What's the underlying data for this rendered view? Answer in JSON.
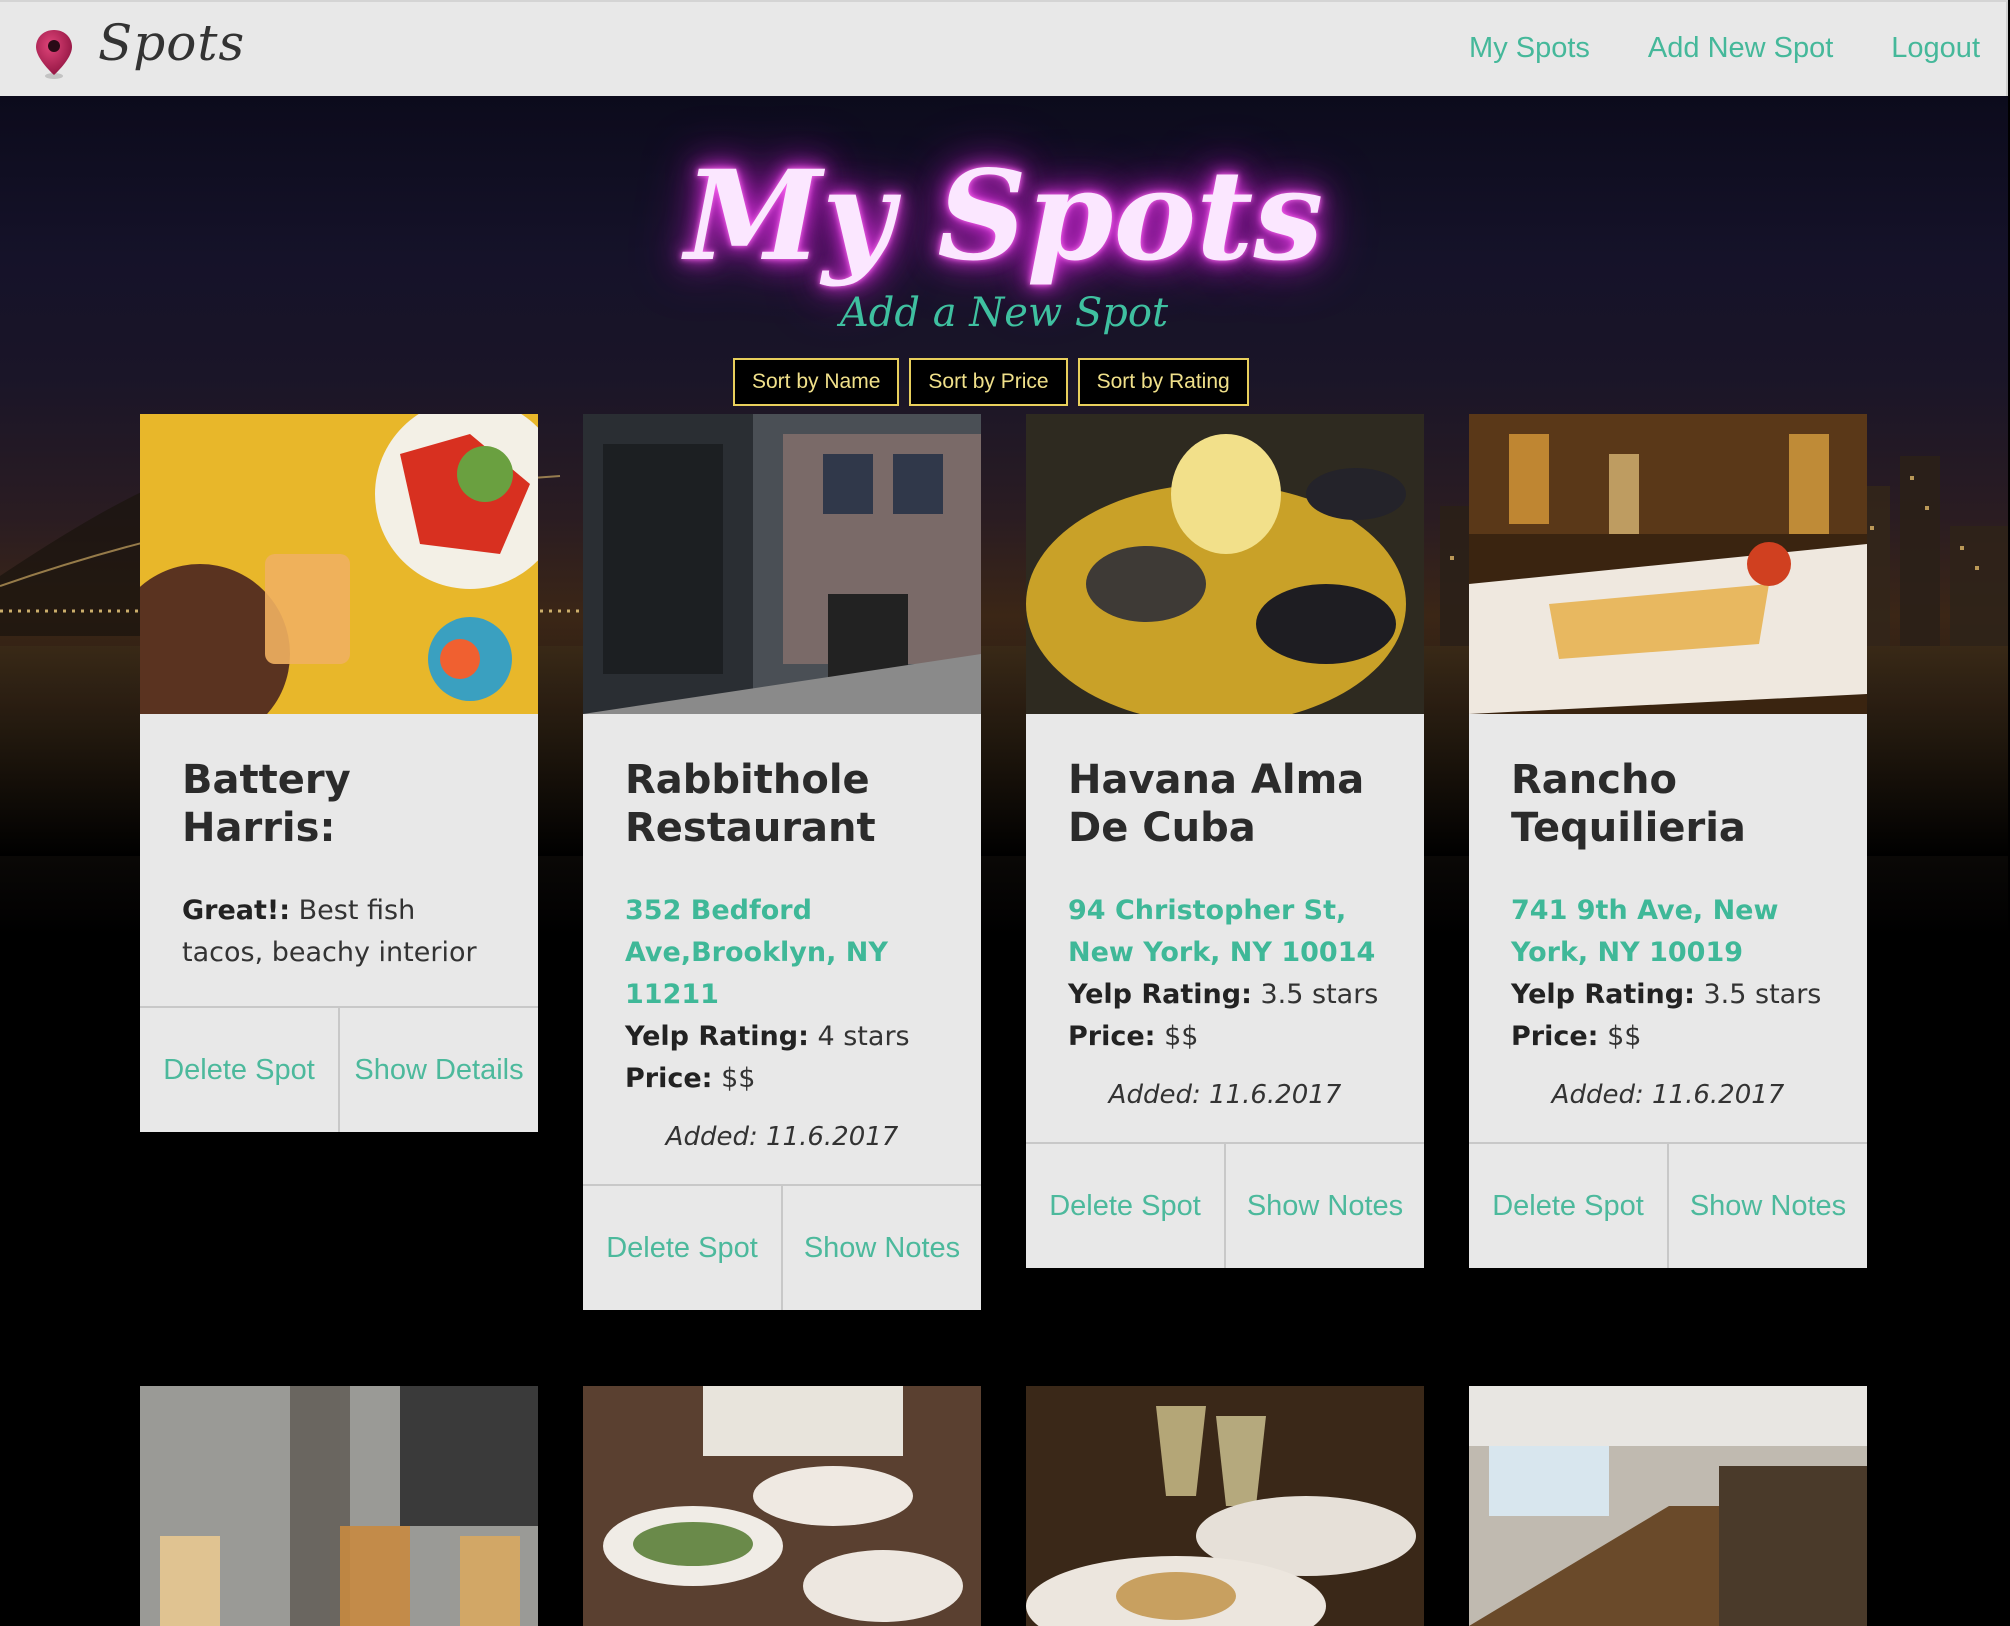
{
  "navbar": {
    "brand": "Spots",
    "links": [
      "My Spots",
      "Add New Spot",
      "Logout"
    ]
  },
  "hero": {
    "title": "My Spots",
    "subtitle": "Add a New Spot"
  },
  "sort_buttons": [
    "Sort by Name",
    "Sort by Price",
    "Sort by Rating"
  ],
  "cards": [
    {
      "name": "Battery Harris:",
      "note_label": "Great!:",
      "note_text": "Best fish tacos, beachy interior",
      "actions": [
        "Delete Spot",
        "Show Details"
      ]
    },
    {
      "name": "Rabbithole Restaurant",
      "address": "352 Bedford Ave,Brooklyn, NY 11211",
      "yelp_label": "Yelp Rating:",
      "yelp_value": "4 stars",
      "price_label": "Price:",
      "price_value": "$$",
      "added": "Added: 11.6.2017",
      "actions": [
        "Delete Spot",
        "Show Notes"
      ]
    },
    {
      "name": "Havana Alma De Cuba",
      "address": "94 Christopher St, New York, NY 10014",
      "yelp_label": "Yelp Rating:",
      "yelp_value": "3.5 stars",
      "price_label": "Price:",
      "price_value": "$$",
      "added": "Added: 11.6.2017",
      "actions": [
        "Delete Spot",
        "Show Notes"
      ]
    },
    {
      "name": "Rancho Tequilieria",
      "address": "741 9th Ave, New York, NY 10019",
      "yelp_label": "Yelp Rating:",
      "yelp_value": "3.5 stars",
      "price_label": "Price:",
      "price_value": "$$",
      "added": "Added: 11.6.2017",
      "actions": [
        "Delete Spot",
        "Show Notes"
      ]
    }
  ],
  "icons": {
    "logo": "map-pin-icon"
  },
  "colors": {
    "accent": "#45b89a",
    "neon": "#e040e0",
    "sort_border": "#e8cf5c",
    "card_bg": "#e8e8e8"
  }
}
